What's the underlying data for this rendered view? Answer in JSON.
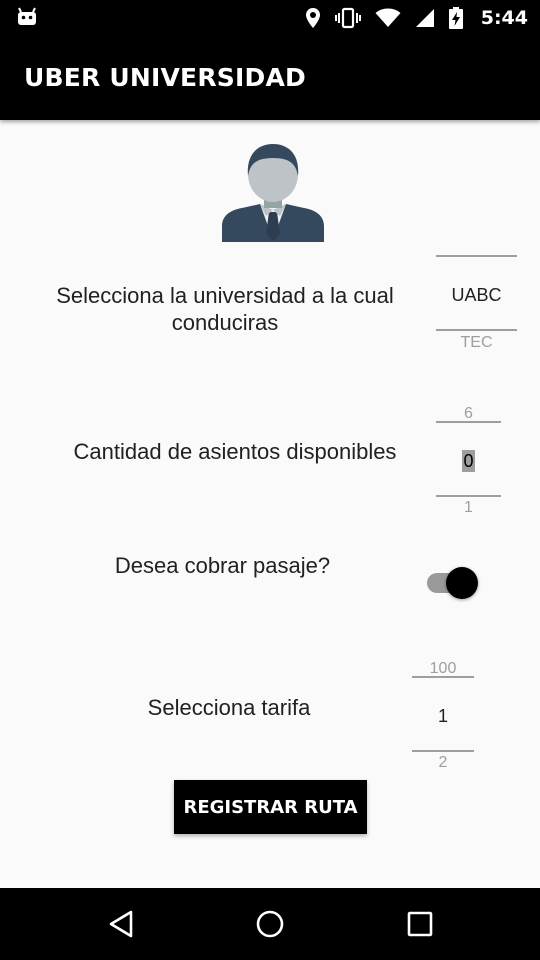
{
  "status_bar": {
    "time": "5:44",
    "icons": [
      "android-icon",
      "location-icon",
      "vibrate-icon",
      "wifi-icon",
      "signal-icon",
      "battery-charging-icon"
    ]
  },
  "app_bar": {
    "title": "UBER UNIVERSIDAD"
  },
  "avatar": {
    "icon": "user-avatar-icon"
  },
  "university": {
    "label": "Selecciona la universidad a la cual conduciras",
    "picker": {
      "above": "",
      "selected": "UABC",
      "below": "TEC"
    }
  },
  "seats": {
    "label": "Cantidad de asientos disponibles",
    "picker": {
      "above": "6",
      "selected": "0",
      "below": "1"
    }
  },
  "fare_toggle": {
    "label": "Desea cobrar pasaje?",
    "checked": true
  },
  "fare": {
    "label": "Selecciona tarifa",
    "picker": {
      "above": "100",
      "selected": "1",
      "below": "2"
    }
  },
  "register_button": {
    "label": "REGISTRAR RUTA"
  },
  "nav_bar": {
    "icons": [
      "back-icon",
      "home-icon",
      "recents-icon"
    ]
  },
  "colors": {
    "app_bar": "#000000",
    "background": "#fafafa",
    "text": "#212121",
    "dim_text": "#9e9e9e"
  }
}
